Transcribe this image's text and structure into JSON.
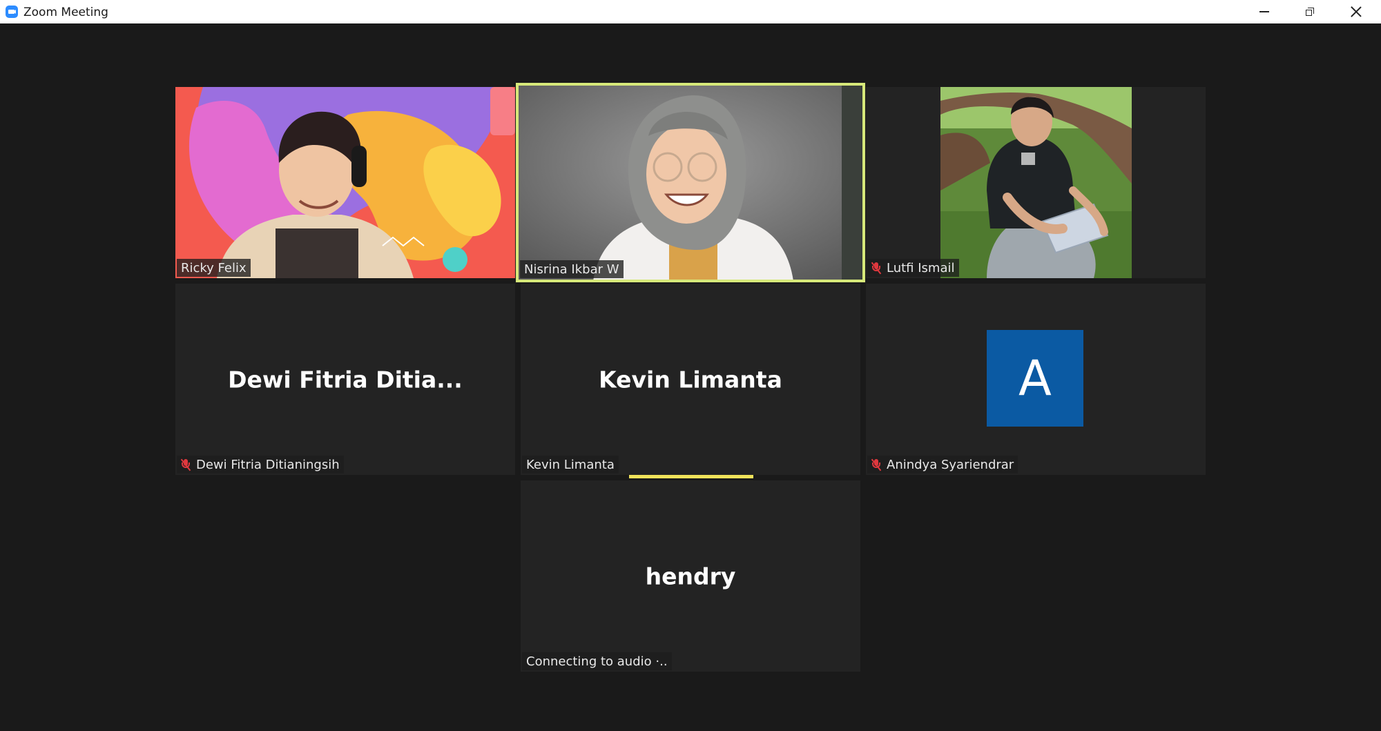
{
  "window": {
    "title": "Zoom Meeting",
    "controls": [
      "minimize",
      "restore",
      "close"
    ]
  },
  "colors": {
    "background": "#1a1a1a",
    "tile": "#232323",
    "active_speaker_border": "#d7e97a",
    "muted_icon": "#e0383e",
    "avatar_bg": "#0b5aa3"
  },
  "participants": [
    {
      "name": "Ricky Felix",
      "video": true,
      "muted": false
    },
    {
      "name": "Nisrina Ikbar W",
      "video": true,
      "muted": false,
      "active_speaker": true
    },
    {
      "name": "Lutfi Ismail",
      "video": true,
      "muted": true
    },
    {
      "name": "Dewi Fitria Ditianingsih",
      "display_name": "Dewi  Fitria  Ditia...",
      "video": false,
      "muted": true
    },
    {
      "name": "Kevin Limanta",
      "display_name": "Kevin Limanta",
      "video": false,
      "muted": false,
      "speaking": true
    },
    {
      "name": "Anindya Syariendrar",
      "avatar_letter": "A",
      "video": false,
      "muted": true
    },
    {
      "name": "hendry",
      "display_name": "hendry",
      "status": "Connecting to audio ·..",
      "video": false
    }
  ]
}
